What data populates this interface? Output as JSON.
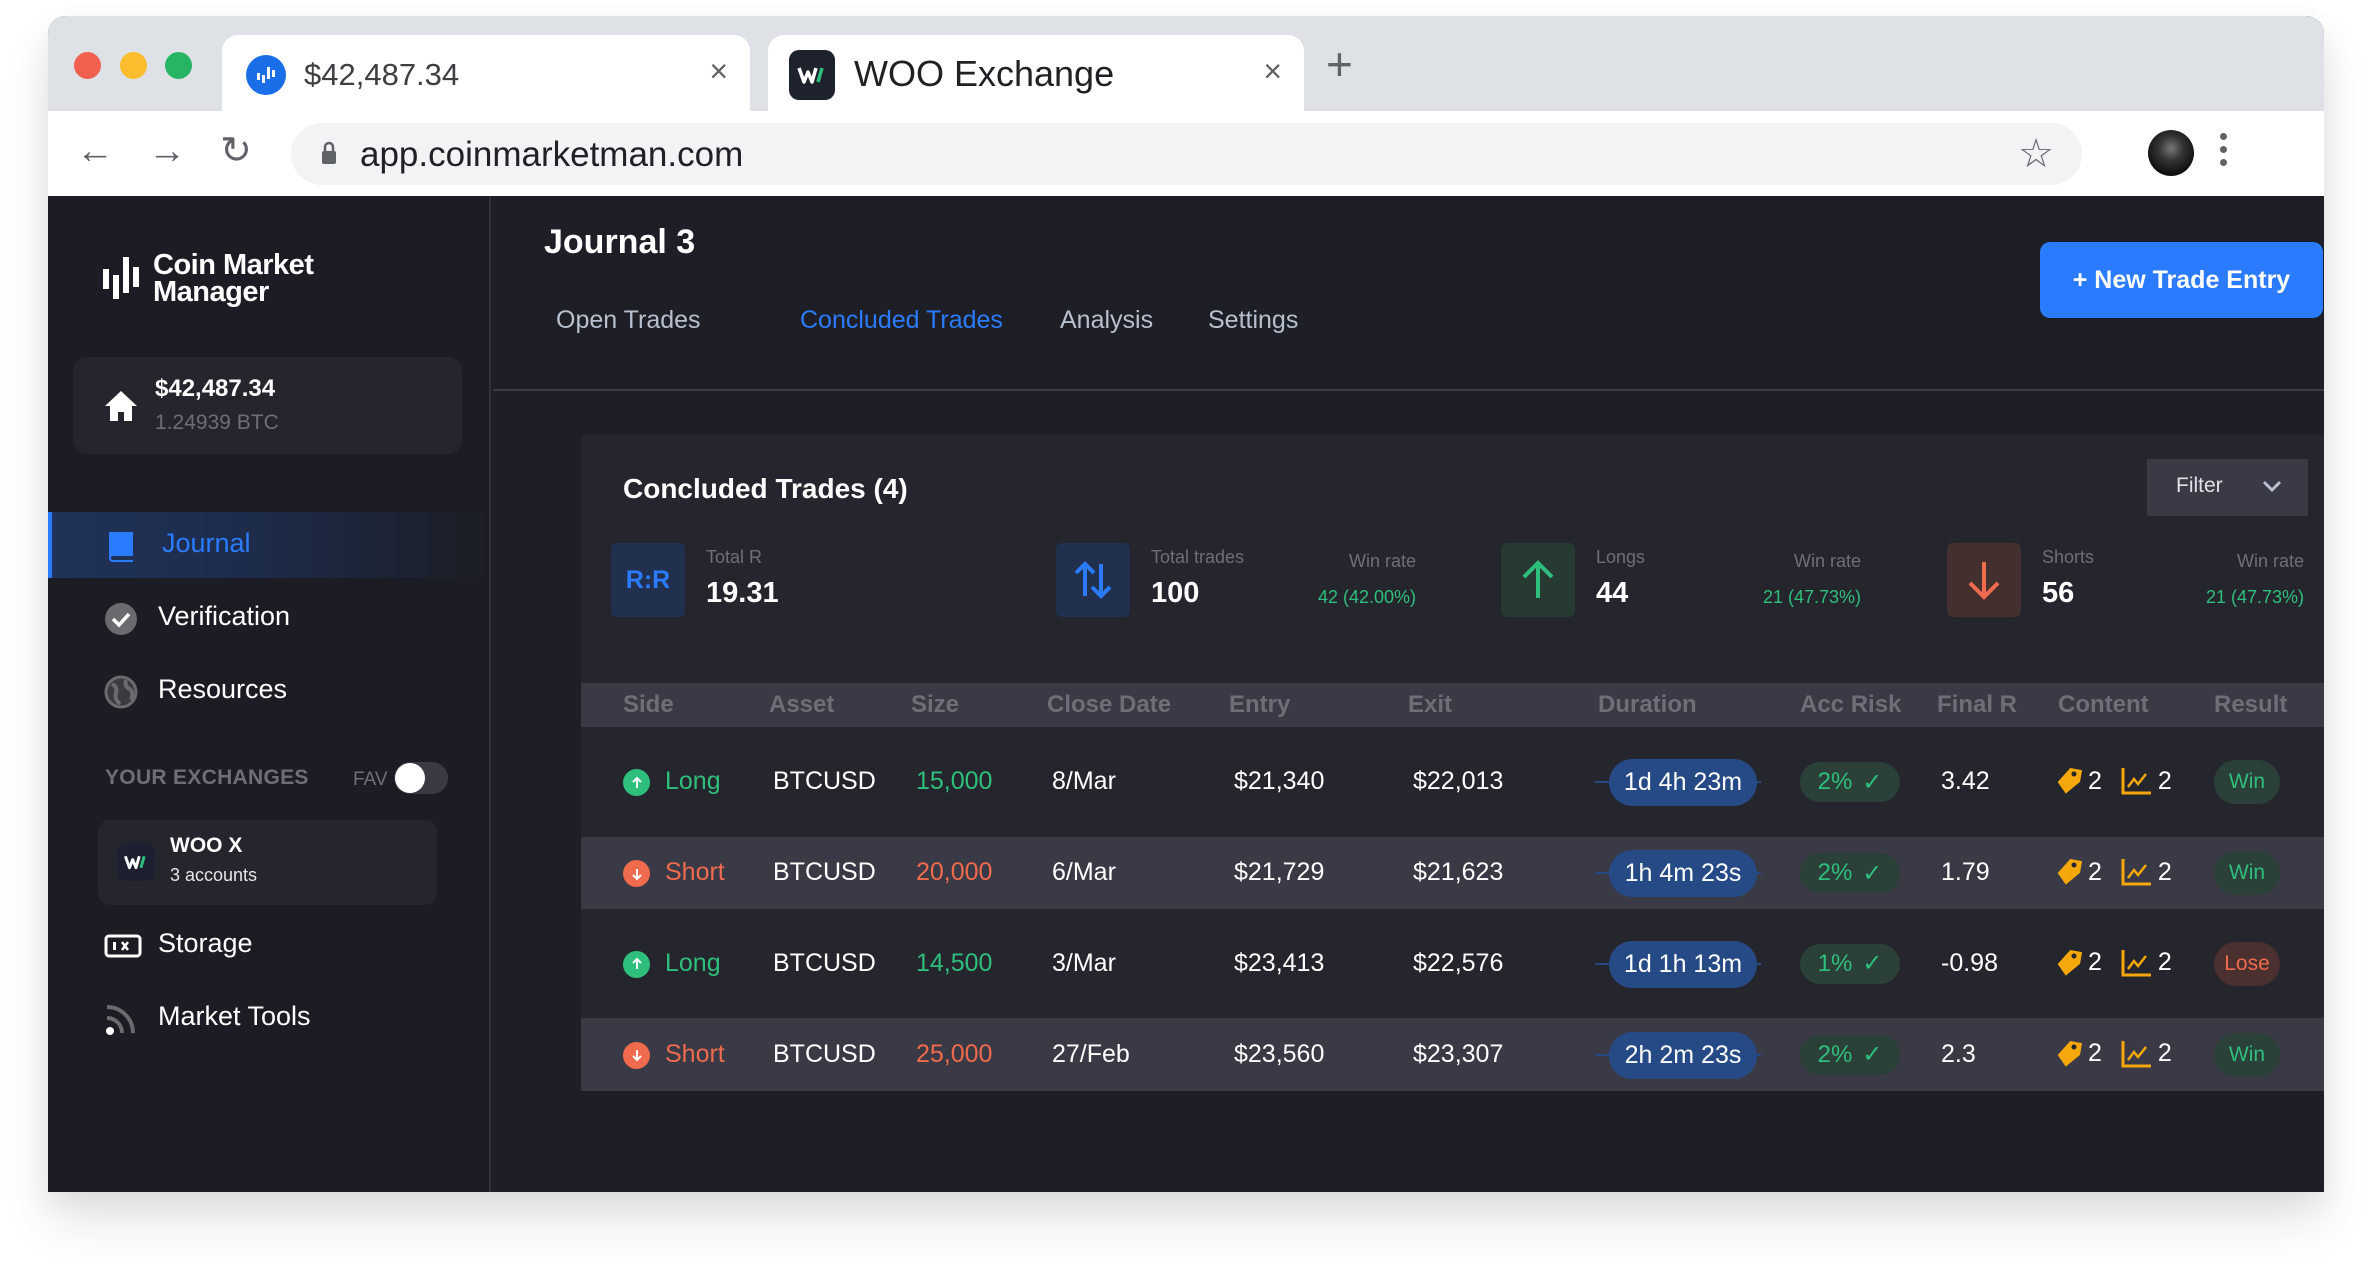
{
  "browser": {
    "tabs": [
      {
        "title": "$42,487.34",
        "icon": "coinmarketman-icon",
        "active": false
      },
      {
        "title": "WOO Exchange",
        "icon": "woo-icon",
        "active": true
      }
    ],
    "close_glyph": "×",
    "new_tab_glyph": "+",
    "url": "app.coinmarketman.com",
    "back_glyph": "←",
    "forward_glyph": "→",
    "reload_glyph": "↻",
    "star_glyph": "☆"
  },
  "sidebar": {
    "logo_line1": "Coin Market",
    "logo_line2": "Manager",
    "balance_usd": "$42,487.34",
    "balance_btc": "1.24939 BTC",
    "nav": [
      {
        "label": "Journal",
        "icon": "book-icon",
        "active": true
      },
      {
        "label": "Verification",
        "icon": "check-circle-icon",
        "active": false
      },
      {
        "label": "Resources",
        "icon": "globe-icon",
        "active": false
      }
    ],
    "exchanges_header": "YOUR EXCHANGES",
    "fav_label": "FAV",
    "fav_on": false,
    "exchange": {
      "name": "WOO X",
      "accounts": "3 accounts"
    },
    "nav2": [
      {
        "label": "Storage",
        "icon": "storage-icon"
      },
      {
        "label": "Market Tools",
        "icon": "signal-icon"
      }
    ]
  },
  "main": {
    "title": "Journal 3",
    "tabs": [
      {
        "label": "Open Trades",
        "active": false
      },
      {
        "label": "Concluded Trades",
        "active": true
      },
      {
        "label": "Analysis",
        "active": false
      },
      {
        "label": "Settings",
        "active": false
      }
    ],
    "new_trade_label": "+ New Trade Entry",
    "panel_title": "Concluded Trades (4)",
    "filter_label": "Filter",
    "stats": {
      "total_r": {
        "icon_text": "R:R",
        "label": "Total R",
        "value": "19.31"
      },
      "total_trades": {
        "label": "Total trades",
        "value": "100",
        "win_rate_label": "Win rate",
        "win_rate": "42 (42.00%)"
      },
      "longs": {
        "label": "Longs",
        "value": "44",
        "win_rate_label": "Win rate",
        "win_rate": "21 (47.73%)"
      },
      "shorts": {
        "label": "Shorts",
        "value": "56",
        "win_rate_label": "Win rate",
        "win_rate": "21 (47.73%)"
      }
    },
    "columns": [
      "Side",
      "Asset",
      "Size",
      "Close Date",
      "Entry",
      "Exit",
      "Duration",
      "Acc Risk",
      "Final R",
      "Content",
      "Result"
    ],
    "rows": [
      {
        "side": "Long",
        "asset": "BTCUSD",
        "size": "15,000",
        "close_date": "8/Mar",
        "entry": "$21,340",
        "exit": "$22,013",
        "duration": "1d 4h 23m",
        "acc_risk": "2%",
        "final_r": "3.42",
        "tags": "2",
        "charts": "2",
        "result": "Win"
      },
      {
        "side": "Short",
        "asset": "BTCUSD",
        "size": "20,000",
        "close_date": "6/Mar",
        "entry": "$21,729",
        "exit": "$21,623",
        "duration": "1h 4m 23s",
        "acc_risk": "2%",
        "final_r": "1.79",
        "tags": "2",
        "charts": "2",
        "result": "Win"
      },
      {
        "side": "Long",
        "asset": "BTCUSD",
        "size": "14,500",
        "close_date": "3/Mar",
        "entry": "$23,413",
        "exit": "$22,576",
        "duration": "1d 1h 13m",
        "acc_risk": "1%",
        "final_r": "-0.98",
        "tags": "2",
        "charts": "2",
        "result": "Lose"
      },
      {
        "side": "Short",
        "asset": "BTCUSD",
        "size": "25,000",
        "close_date": "27/Feb",
        "entry": "$23,560",
        "exit": "$23,307",
        "duration": "2h 2m 23s",
        "acc_risk": "2%",
        "final_r": "2.3",
        "tags": "2",
        "charts": "2",
        "result": "Win"
      }
    ],
    "check_glyph": "✓"
  },
  "colors": {
    "accent": "#2a7bff",
    "long": "#2fbf7c",
    "short": "#f06a4e",
    "tag": "#f5a70c",
    "bg": "#1e1f26",
    "panel": "#25262d"
  }
}
